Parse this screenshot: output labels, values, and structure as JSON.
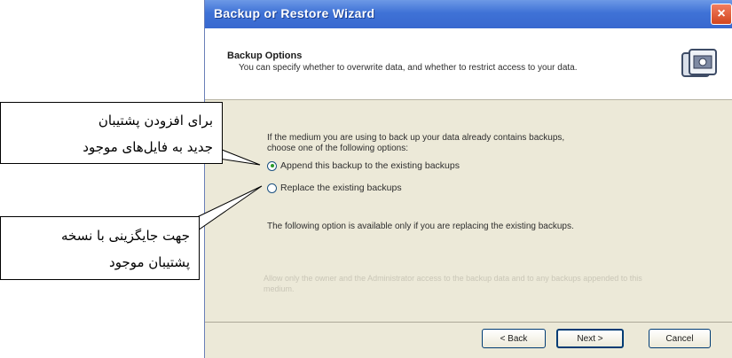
{
  "window": {
    "title": "Backup or Restore Wizard",
    "close_glyph": "×"
  },
  "header": {
    "title": "Backup Options",
    "description": "You can specify whether to overwrite data, and whether to restrict access to your data."
  },
  "body": {
    "intro": "If the medium you are using to back up your data already contains backups, choose one of the following options:",
    "options": [
      {
        "label": "Append this backup to the existing backups",
        "checked": true
      },
      {
        "label": "Replace the existing backups",
        "checked": false
      }
    ],
    "note": "The following option is available only if you are replacing the existing backups.",
    "disabled_option": "Allow only the owner and the Administrator access to the backup data and to any backups appended to this medium."
  },
  "buttons": {
    "back": "< Back",
    "next": "Next >",
    "cancel": "Cancel"
  },
  "callouts": [
    {
      "line1": "برای افزودن پشتیبان",
      "line2": "جدید به فایل‌های موجود"
    },
    {
      "line1": "جهت جایگزینی  با نسخه",
      "line2": "پشتیبان موجود"
    }
  ],
  "colors": {
    "titlebar": "#3f72d6",
    "window_bg": "#ece9d8",
    "close": "#d2461f"
  }
}
